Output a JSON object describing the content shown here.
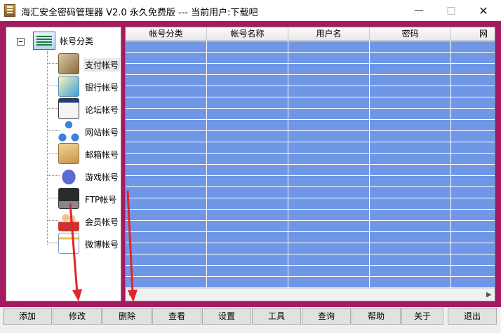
{
  "window": {
    "title": "海汇安全密码管理器 V2.0 永久免费版 --- 当前用户:下载吧",
    "min_icon": "minimize-icon",
    "max_icon": "maximize-icon",
    "close_icon": "close-icon"
  },
  "tree": {
    "root_label": "帐号分类",
    "items": [
      {
        "label": "支付帐号",
        "icon": "payment-icon",
        "selected": true
      },
      {
        "label": "银行帐号",
        "icon": "bank-card-icon"
      },
      {
        "label": "论坛帐号",
        "icon": "forum-icon"
      },
      {
        "label": "网站帐号",
        "icon": "network-icon"
      },
      {
        "label": "邮箱帐号",
        "icon": "mail-icon"
      },
      {
        "label": "游戏帐号",
        "icon": "gamepad-icon"
      },
      {
        "label": "FTP帐号",
        "icon": "computer-icon"
      },
      {
        "label": "会员帐号",
        "icon": "users-icon"
      },
      {
        "label": "微博帐号",
        "icon": "notepad-icon"
      }
    ]
  },
  "grid": {
    "columns": [
      "帐号分类",
      "帐号名称",
      "用户名",
      "密码",
      "网"
    ],
    "row_color": "#6f97e6"
  },
  "toolbar": {
    "buttons": [
      "添加",
      "修改",
      "删除",
      "查看",
      "设置",
      "工具",
      "查询",
      "帮助",
      "关于",
      "退出"
    ]
  },
  "colors": {
    "frame": "#a51b60",
    "annotation_arrow": "#e0262a"
  }
}
